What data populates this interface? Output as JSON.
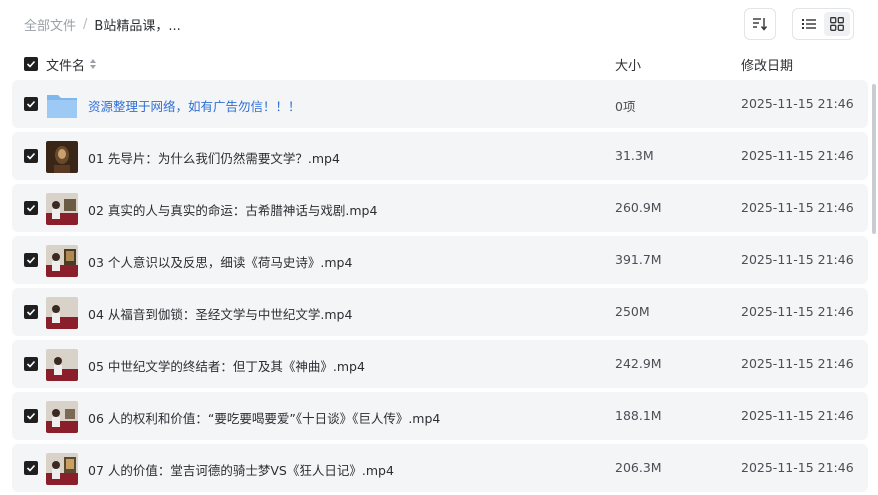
{
  "breadcrumb": {
    "root": "全部文件",
    "separator": "/",
    "current": "B站精品课，..."
  },
  "toolbar": {
    "sort_icon": "sort-icon",
    "list_view_icon": "list-view-icon",
    "grid_view_icon": "grid-view-icon"
  },
  "columns": {
    "name": "文件名",
    "size": "大小",
    "date": "修改日期"
  },
  "files": [
    {
      "name": "资源整理于网络，如有广告勿信！！！",
      "size": "0项",
      "date": "2025-11-15 21:46",
      "type": "folder"
    },
    {
      "name": "01 先导片：为什么我们仍然需要文学？.mp4",
      "size": "31.3M",
      "date": "2025-11-15 21:46",
      "type": "video"
    },
    {
      "name": "02 真实的人与真实的命运：古希腊神话与戏剧.mp4",
      "size": "260.9M",
      "date": "2025-11-15 21:46",
      "type": "video"
    },
    {
      "name": "03 个人意识以及反思，细读《荷马史诗》.mp4",
      "size": "391.7M",
      "date": "2025-11-15 21:46",
      "type": "video"
    },
    {
      "name": "04 从福音到伽锁：圣经文学与中世纪文学.mp4",
      "size": "250M",
      "date": "2025-11-15 21:46",
      "type": "video"
    },
    {
      "name": "05 中世纪文学的终结者：但丁及其《神曲》.mp4",
      "size": "242.9M",
      "date": "2025-11-15 21:46",
      "type": "video"
    },
    {
      "name": "06 人的权利和价值：“要吃要喝要爱”《十日谈》《巨人传》.mp4",
      "size": "188.1M",
      "date": "2025-11-15 21:46",
      "type": "video"
    },
    {
      "name": "07 人的价值：堂吉诃德的骑士梦VS《狂人日记》.mp4",
      "size": "206.3M",
      "date": "2025-11-15 21:46",
      "type": "video"
    }
  ]
}
